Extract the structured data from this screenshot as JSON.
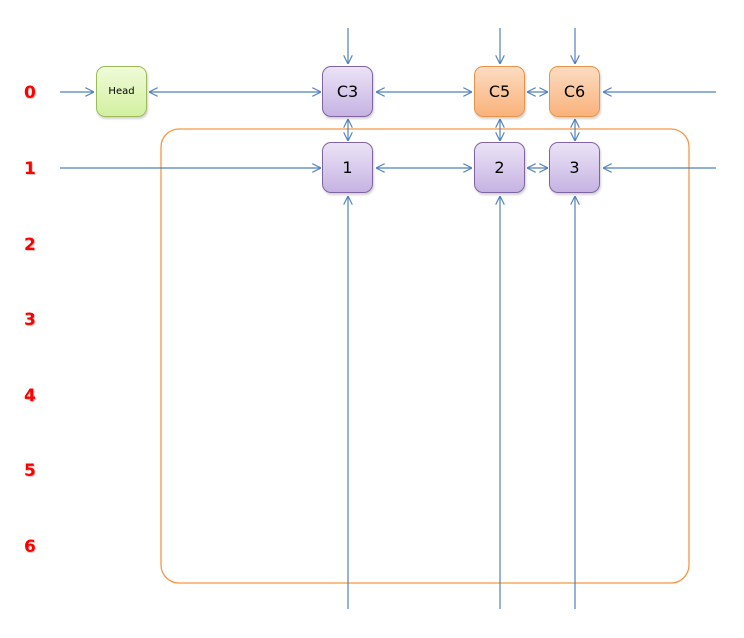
{
  "diagram": {
    "title": "",
    "colors": {
      "row_label": "#ff0000",
      "link": "#4f81bd",
      "container": "#f79646",
      "head_fill": "#d7f2a8",
      "column_header_fill": "#fac090",
      "cell_fill": "#ccc0e4"
    },
    "row_labels": [
      "0",
      "1",
      "2",
      "3",
      "4",
      "5",
      "6"
    ],
    "nodes": {
      "head": {
        "label": "Head",
        "type": "head",
        "row": 0
      },
      "c3": {
        "label": "C3",
        "type": "column-header",
        "row": 0,
        "column": 3
      },
      "c5": {
        "label": "C5",
        "type": "column-header",
        "row": 0,
        "column": 5
      },
      "c6": {
        "label": "C6",
        "type": "column-header",
        "row": 0,
        "column": 6
      },
      "n1": {
        "label": "1",
        "type": "cell",
        "row": 1,
        "column": 3
      },
      "n2": {
        "label": "2",
        "type": "cell",
        "row": 1,
        "column": 5
      },
      "n3": {
        "label": "3",
        "type": "cell",
        "row": 1,
        "column": 6
      }
    },
    "edges": [
      {
        "from": "left-wrap-row0",
        "to": "head",
        "direction": "forward"
      },
      {
        "from": "head",
        "to": "c3",
        "direction": "both"
      },
      {
        "from": "c3",
        "to": "c5",
        "direction": "both"
      },
      {
        "from": "c5",
        "to": "c6",
        "direction": "both"
      },
      {
        "from": "right-wrap-row0",
        "to": "c6",
        "direction": "forward"
      },
      {
        "from": "left-wrap-row1",
        "to": "n1",
        "direction": "forward"
      },
      {
        "from": "n1",
        "to": "n2",
        "direction": "both"
      },
      {
        "from": "n2",
        "to": "n3",
        "direction": "both"
      },
      {
        "from": "right-wrap-row1",
        "to": "n3",
        "direction": "forward"
      },
      {
        "from": "top-wrap-c3",
        "to": "c3",
        "direction": "forward"
      },
      {
        "from": "top-wrap-c5",
        "to": "c5",
        "direction": "forward"
      },
      {
        "from": "top-wrap-c6",
        "to": "c6",
        "direction": "forward"
      },
      {
        "from": "c3",
        "to": "n1",
        "direction": "both"
      },
      {
        "from": "c5",
        "to": "n2",
        "direction": "both"
      },
      {
        "from": "c6",
        "to": "n3",
        "direction": "both"
      },
      {
        "from": "bottom-wrap-c3",
        "to": "n1",
        "direction": "forward"
      },
      {
        "from": "bottom-wrap-c5",
        "to": "n2",
        "direction": "forward"
      },
      {
        "from": "bottom-wrap-c6",
        "to": "n3",
        "direction": "forward"
      }
    ]
  }
}
